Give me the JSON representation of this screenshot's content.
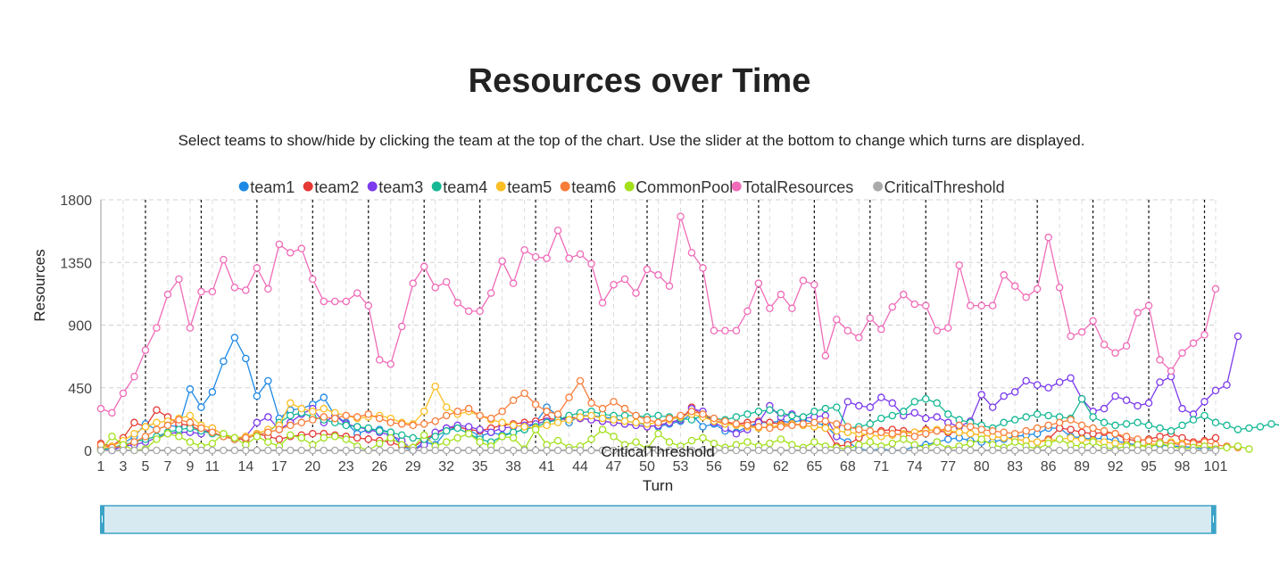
{
  "page": {
    "title": "Resources over Time",
    "subtitle": "Select teams to show/hide by clicking the team at the top of the chart. Use the slider at the bottom to change which turns are displayed."
  },
  "chart_data": {
    "type": "line",
    "title": "Resources over Time",
    "xlabel": "Turn",
    "ylabel": "Resources",
    "ylim": [
      0,
      1800
    ],
    "yticks": [
      0,
      450,
      900,
      1350,
      1800
    ],
    "xlim": [
      1,
      101
    ],
    "xticks": [
      1,
      3,
      5,
      7,
      9,
      11,
      14,
      17,
      20,
      23,
      26,
      29,
      32,
      35,
      38,
      41,
      44,
      47,
      50,
      53,
      56,
      59,
      62,
      65,
      68,
      71,
      74,
      77,
      80,
      83,
      86,
      89,
      92,
      95,
      98,
      101
    ],
    "grid": true,
    "legend_position": "top",
    "threshold_label": "CriticalThreshold",
    "season_markers": [
      5,
      10,
      15,
      20,
      25,
      30,
      35,
      40,
      45,
      50,
      55,
      60,
      65,
      70,
      75,
      80,
      85,
      90,
      95,
      100
    ],
    "slider": {
      "from_turn": 1,
      "to_turn": 101
    },
    "series": [
      {
        "name": "team1",
        "color": "#1e88e5",
        "values": [
          10,
          0,
          50,
          100,
          190,
          150,
          180,
          170,
          440,
          310,
          420,
          640,
          810,
          660,
          390,
          500,
          230,
          290,
          300,
          330,
          380,
          250,
          200,
          120,
          150,
          150,
          130,
          30,
          0,
          60,
          40,
          140,
          170,
          150,
          100,
          130,
          110,
          130,
          150,
          200,
          310,
          250,
          200,
          250,
          250,
          240,
          230,
          210,
          200,
          180,
          170,
          190,
          210,
          260,
          170,
          190,
          140,
          130,
          170,
          200,
          200,
          210,
          200,
          220,
          200,
          180,
          100,
          60,
          10,
          0,
          10,
          0,
          0,
          30,
          40,
          60,
          80,
          90,
          70,
          60,
          60,
          80,
          100,
          110,
          120,
          160,
          160,
          100,
          90,
          80,
          90,
          70,
          50,
          40,
          30,
          40,
          30,
          30,
          20,
          10,
          20
        ]
      },
      {
        "name": "team2",
        "color": "#e53935",
        "values": [
          50,
          30,
          90,
          200,
          170,
          290,
          240,
          190,
          180,
          140,
          130,
          100,
          80,
          80,
          120,
          100,
          80,
          100,
          110,
          120,
          120,
          110,
          100,
          90,
          80,
          70,
          60,
          30,
          20,
          80,
          120,
          160,
          170,
          150,
          140,
          160,
          180,
          190,
          200,
          210,
          230,
          220,
          240,
          230,
          220,
          210,
          200,
          190,
          180,
          170,
          180,
          200,
          220,
          310,
          250,
          210,
          200,
          190,
          200,
          210,
          200,
          190,
          190,
          180,
          170,
          160,
          30,
          40,
          90,
          130,
          140,
          150,
          140,
          130,
          150,
          140,
          130,
          130,
          120,
          110,
          100,
          90,
          80,
          70,
          60,
          80,
          160,
          150,
          130,
          120,
          130,
          120,
          80,
          70,
          80,
          100,
          120,
          90,
          60,
          70,
          90
        ]
      },
      {
        "name": "team3",
        "color": "#7c3aed",
        "values": [
          20,
          0,
          30,
          40,
          60,
          90,
          120,
          130,
          130,
          120,
          160,
          110,
          80,
          100,
          200,
          240,
          150,
          200,
          260,
          300,
          200,
          250,
          190,
          170,
          150,
          130,
          110,
          70,
          0,
          40,
          130,
          160,
          180,
          170,
          150,
          130,
          160,
          170,
          180,
          190,
          210,
          220,
          230,
          230,
          220,
          210,
          200,
          190,
          180,
          170,
          180,
          200,
          220,
          300,
          280,
          200,
          160,
          120,
          150,
          200,
          320,
          240,
          260,
          230,
          240,
          250,
          100,
          350,
          320,
          310,
          380,
          340,
          250,
          270,
          230,
          240,
          200,
          170,
          210,
          400,
          310,
          390,
          420,
          500,
          470,
          450,
          490,
          520,
          370,
          280,
          300,
          390,
          360,
          320,
          340,
          490,
          530,
          300,
          260,
          350,
          430,
          470,
          820
        ]
      },
      {
        "name": "team4",
        "color": "#14b894",
        "values": [
          0,
          20,
          40,
          60,
          80,
          100,
          130,
          150,
          160,
          140,
          120,
          100,
          80,
          90,
          110,
          130,
          200,
          250,
          270,
          240,
          220,
          200,
          180,
          170,
          160,
          140,
          130,
          110,
          90,
          80,
          100,
          140,
          160,
          120,
          80,
          60,
          100,
          130,
          150,
          170,
          200,
          220,
          250,
          270,
          280,
          260,
          250,
          250,
          250,
          240,
          250,
          240,
          230,
          220,
          250,
          230,
          220,
          240,
          260,
          280,
          290,
          270,
          250,
          240,
          280,
          300,
          310,
          160,
          170,
          190,
          230,
          250,
          280,
          350,
          370,
          340,
          260,
          220,
          200,
          180,
          160,
          200,
          220,
          240,
          260,
          250,
          240,
          230,
          370,
          240,
          200,
          180,
          190,
          200,
          180,
          160,
          140,
          180,
          220,
          250,
          200,
          180,
          150,
          160,
          170,
          190,
          180,
          200,
          190,
          170
        ]
      },
      {
        "name": "team5",
        "color": "#fbbf24",
        "values": [
          10,
          30,
          70,
          120,
          170,
          200,
          210,
          230,
          250,
          180,
          160,
          110,
          90,
          100,
          120,
          150,
          180,
          340,
          300,
          280,
          300,
          270,
          250,
          230,
          240,
          250,
          230,
          200,
          190,
          280,
          460,
          310,
          260,
          280,
          250,
          220,
          200,
          180,
          170,
          160,
          180,
          200,
          220,
          240,
          250,
          230,
          220,
          210,
          200,
          190,
          200,
          220,
          240,
          260,
          240,
          210,
          190,
          180,
          170,
          160,
          170,
          180,
          190,
          180,
          170,
          160,
          140,
          130,
          120,
          110,
          100,
          110,
          120,
          130,
          140,
          150,
          140,
          130,
          120,
          110,
          100,
          90,
          80,
          70,
          60,
          70,
          80,
          90,
          80,
          70,
          60,
          50,
          40,
          30,
          40,
          50,
          60,
          50,
          40,
          30,
          20
        ]
      },
      {
        "name": "team6",
        "color": "#f97d3a",
        "values": [
          40,
          20,
          30,
          60,
          100,
          150,
          180,
          220,
          200,
          160,
          130,
          100,
          80,
          90,
          110,
          130,
          150,
          180,
          200,
          220,
          240,
          230,
          250,
          240,
          260,
          230,
          200,
          190,
          180,
          190,
          210,
          250,
          280,
          300,
          250,
          230,
          280,
          360,
          410,
          330,
          280,
          260,
          380,
          500,
          340,
          300,
          350,
          300,
          250,
          220,
          200,
          230,
          250,
          280,
          260,
          230,
          210,
          190,
          180,
          170,
          160,
          170,
          180,
          190,
          200,
          210,
          190,
          170,
          150,
          140,
          130,
          120,
          110,
          100,
          120,
          140,
          160,
          180,
          170,
          150,
          140,
          130,
          120,
          140,
          160,
          180,
          200,
          220,
          180,
          160,
          140,
          120,
          100,
          80,
          70,
          60,
          50,
          40,
          50,
          60,
          40,
          30,
          20
        ]
      },
      {
        "name": "CommonPool",
        "color": "#a3e01c",
        "values": [
          0,
          100,
          40,
          0,
          10,
          80,
          120,
          100,
          60,
          30,
          50,
          120,
          90,
          40,
          100,
          60,
          30,
          110,
          90,
          40,
          90,
          100,
          80,
          30,
          0,
          50,
          90,
          40,
          20,
          110,
          30,
          60,
          90,
          120,
          60,
          30,
          100,
          90,
          10,
          150,
          40,
          70,
          20,
          30,
          80,
          150,
          100,
          40,
          60,
          10,
          120,
          60,
          30,
          70,
          90,
          50,
          20,
          40,
          60,
          30,
          50,
          80,
          40,
          20,
          60,
          30,
          20,
          10,
          40,
          60,
          30,
          50,
          80,
          40,
          20,
          60,
          10,
          30,
          50,
          80,
          40,
          20,
          60,
          30,
          10,
          50,
          80,
          40,
          30,
          60,
          20,
          10,
          30,
          40,
          20,
          50,
          30,
          10,
          20,
          30,
          10,
          20,
          30,
          10
        ]
      },
      {
        "name": "TotalResources",
        "color": "#f06bb8",
        "values": [
          300,
          270,
          410,
          530,
          720,
          880,
          1120,
          1230,
          880,
          1140,
          1140,
          1370,
          1170,
          1150,
          1310,
          1160,
          1480,
          1420,
          1450,
          1230,
          1070,
          1070,
          1070,
          1130,
          1040,
          650,
          620,
          890,
          1200,
          1320,
          1170,
          1210,
          1060,
          1000,
          1000,
          1130,
          1360,
          1200,
          1440,
          1390,
          1380,
          1580,
          1380,
          1410,
          1340,
          1060,
          1190,
          1230,
          1130,
          1300,
          1260,
          1180,
          1680,
          1420,
          1310,
          860,
          860,
          860,
          1000,
          1200,
          1020,
          1120,
          1020,
          1220,
          1190,
          680,
          940,
          860,
          810,
          950,
          870,
          1030,
          1120,
          1050,
          1040,
          860,
          880,
          1330,
          1040,
          1040,
          1040,
          1260,
          1180,
          1100,
          1160,
          1530,
          1170,
          820,
          850,
          930,
          760,
          700,
          750,
          990,
          1040,
          650,
          570,
          700,
          770,
          830,
          1160
        ]
      },
      {
        "name": "CriticalThreshold",
        "color": "#aaaaaa",
        "values": [
          0,
          0,
          0,
          0,
          0,
          0,
          0,
          0,
          0,
          0,
          0,
          0,
          0,
          0,
          0,
          0,
          0,
          0,
          0,
          0,
          0,
          0,
          0,
          0,
          0,
          0,
          0,
          0,
          0,
          0,
          0,
          0,
          0,
          0,
          0,
          0,
          0,
          0,
          0,
          0,
          0,
          0,
          0,
          0,
          0,
          0,
          0,
          0,
          0,
          0,
          0,
          0,
          0,
          0,
          0,
          0,
          0,
          0,
          0,
          0,
          0,
          0,
          0,
          0,
          0,
          0,
          0,
          0,
          0,
          0,
          0,
          0,
          0,
          0,
          0,
          0,
          0,
          0,
          0,
          0,
          0,
          0,
          0,
          0,
          0,
          0,
          0,
          0,
          0,
          0,
          0,
          0,
          0,
          0,
          0,
          0,
          0,
          0,
          0,
          0,
          0
        ]
      }
    ]
  }
}
